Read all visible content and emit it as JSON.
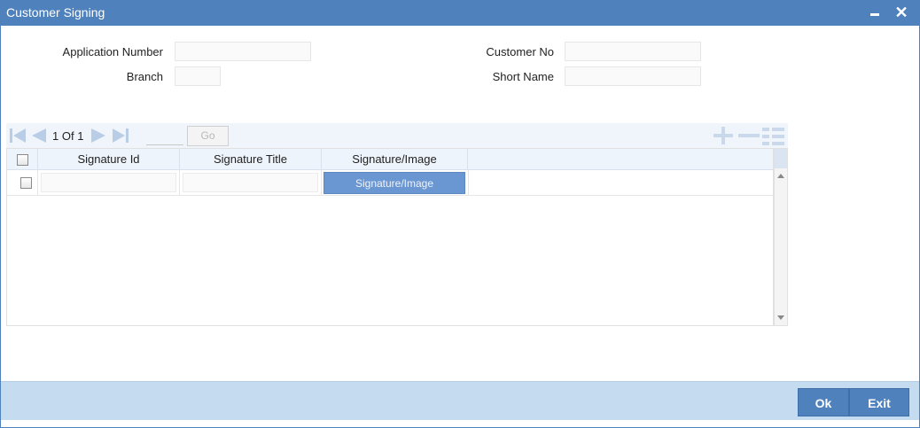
{
  "window": {
    "title": "Customer Signing",
    "minimize_icon": "minimize-icon",
    "close_icon": "close-icon"
  },
  "form": {
    "application_number": {
      "label": "Application Number",
      "value": ""
    },
    "customer_no": {
      "label": "Customer No",
      "value": ""
    },
    "branch": {
      "label": "Branch",
      "value": ""
    },
    "short_name": {
      "label": "Short Name",
      "value": ""
    }
  },
  "grid": {
    "pager": {
      "current": "1",
      "of_label": "Of",
      "total": "1",
      "page_input": "",
      "go_label": "Go"
    },
    "icons": [
      "first-page-icon",
      "previous-page-icon",
      "next-page-icon",
      "last-page-icon",
      "add-row-icon",
      "delete-row-icon",
      "single-view-icon"
    ],
    "columns": [
      "Signature Id",
      "Signature Title",
      "Signature/Image"
    ],
    "rows": [
      {
        "signature_id": "",
        "signature_title": "",
        "button_label": "Signature/Image"
      }
    ]
  },
  "footer": {
    "ok_label": "Ok",
    "exit_label": "Exit"
  },
  "colors": {
    "title_bar": "#4f81bd",
    "footer": "#c5dcf0",
    "button": "#4f81bd",
    "grid_button": "#6a96d2"
  }
}
